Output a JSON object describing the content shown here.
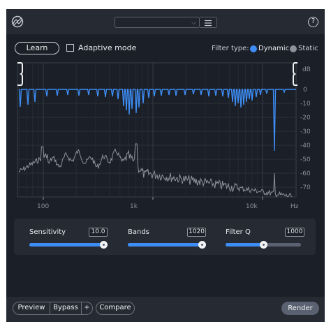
{
  "header": {
    "logo_icon": "spectral-logo-icon",
    "preset_value": "",
    "menu_icon": "hamburger-menu-icon",
    "help_label": "?"
  },
  "toolbar": {
    "learn_label": "Learn",
    "adaptive_mode_label": "Adaptive mode",
    "adaptive_mode_checked": false,
    "filter_type_label": "Filter type:",
    "filter_type_options": [
      "Dynamic",
      "Static"
    ],
    "filter_type_selected": "Dynamic"
  },
  "graph": {
    "unit_label": "dB",
    "db_ticks": [
      "0",
      "-10",
      "-20",
      "-30",
      "-40",
      "-50",
      "-60",
      "-70"
    ],
    "freq_ticks": [
      "100",
      "1k",
      "10k"
    ],
    "freq_unit": "Hz",
    "colors": {
      "filter_curve": "#3d8df5",
      "spectrum": "#8d929b",
      "background": "#1b1f27"
    }
  },
  "controls": {
    "sensitivity": {
      "label": "Sensitivity",
      "value": "10.0",
      "fraction": 1.0
    },
    "bands": {
      "label": "Bands",
      "value": "1020",
      "fraction": 1.0
    },
    "filter_q": {
      "label": "Filter Q",
      "value": "1000",
      "fraction": 0.5
    }
  },
  "footer": {
    "preview_label": "Preview",
    "bypass_label": "Bypass",
    "plus_label": "+",
    "compare_label": "Compare",
    "render_label": "Render"
  }
}
